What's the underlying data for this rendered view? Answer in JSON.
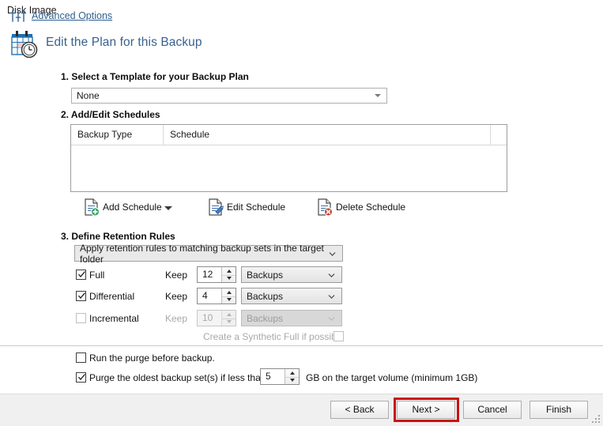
{
  "window": {
    "title": "Disk Image"
  },
  "header": {
    "icon": "calendar-clock-icon",
    "title": "Edit the Plan for this Backup",
    "title_color": "#37618d"
  },
  "steps": {
    "template": {
      "label": "1. Select a Template for your Backup Plan",
      "dropdown": {
        "value": "None",
        "icon": "caret-down-icon"
      }
    },
    "schedules": {
      "label": "2. Add/Edit Schedules",
      "table": {
        "columns": [
          "Backup Type",
          "Schedule",
          ""
        ],
        "rows": []
      },
      "toolbar": [
        {
          "label": "Add Schedule",
          "icon": "document-add-icon",
          "has_split": true,
          "split_icon": "caret-down-icon"
        },
        {
          "label": "Edit Schedule",
          "icon": "document-edit-icon",
          "has_split": false
        },
        {
          "label": "Delete Schedule",
          "icon": "document-delete-icon",
          "has_split": false
        }
      ]
    },
    "retention": {
      "label": "3. Define Retention Rules",
      "scope_dropdown": {
        "value": "Apply retention rules to matching backup sets in the target folder",
        "icon": "chevron-down-icon"
      },
      "rules": [
        {
          "name": "Full",
          "checked": true,
          "enabled": true,
          "keep_label": "Keep",
          "count": "12",
          "unit": "Backups"
        },
        {
          "name": "Differential",
          "checked": true,
          "enabled": true,
          "keep_label": "Keep",
          "count": "4",
          "unit": "Backups"
        },
        {
          "name": "Incremental",
          "checked": false,
          "enabled": false,
          "keep_label": "Keep",
          "count": "10",
          "unit": "Backups"
        }
      ],
      "synthetic_full": {
        "label": "Create a Synthetic Full if possible",
        "checked": false,
        "enabled": false
      }
    }
  },
  "purge": {
    "run_before": {
      "label": "Run the purge before backup.",
      "checked": false
    },
    "oldest_set": {
      "label": "Purge the oldest backup set(s) if less than",
      "checked": true,
      "value": "5",
      "suffix": "GB on the target volume (minimum 1GB)"
    }
  },
  "footer": {
    "advanced_options": {
      "label": "Advanced Options",
      "icon": "sliders-icon"
    },
    "buttons": [
      {
        "label": "< Back",
        "highlighted": false
      },
      {
        "label": "Next >",
        "highlighted": true
      },
      {
        "label": "Cancel",
        "highlighted": false
      },
      {
        "label": "Finish",
        "highlighted": false
      }
    ],
    "highlight_color": "#cc1111",
    "resize_grip": "resize-grip-icon"
  }
}
